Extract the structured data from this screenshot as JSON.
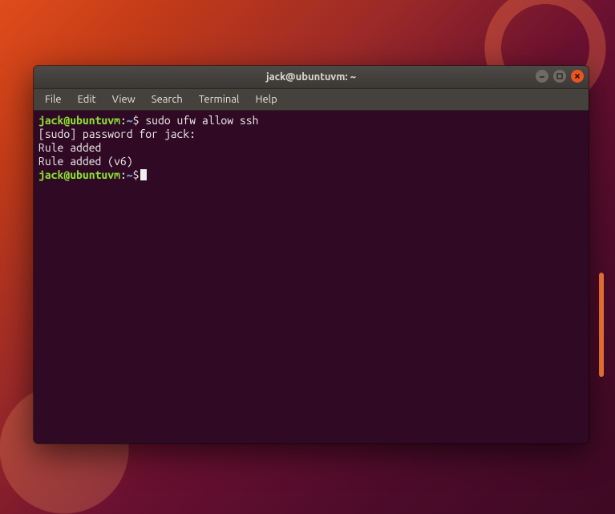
{
  "window": {
    "title": "jack@ubuntuvm: ~"
  },
  "menubar": {
    "items": [
      "File",
      "Edit",
      "View",
      "Search",
      "Terminal",
      "Help"
    ]
  },
  "prompt": {
    "user": "jack",
    "at": "@",
    "host": "ubuntuvm",
    "colon": ":",
    "path": "~",
    "symbol": "$"
  },
  "terminal": {
    "command1": " sudo ufw allow ssh",
    "line2": "[sudo] password for jack:",
    "line3": "Rule added",
    "line4": "Rule added (v6)"
  },
  "colors": {
    "prompt_user_host": "#8ae234",
    "prompt_path": "#729fcf",
    "terminal_bg": "#300a24",
    "close_button": "#e95420"
  }
}
